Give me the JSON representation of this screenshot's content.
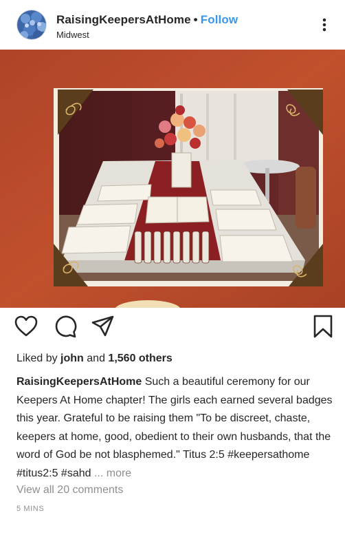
{
  "post": {
    "username": "RaisingKeepersAtHome",
    "separator": "•",
    "follow_label": "Follow",
    "location": "Midwest",
    "likes_prefix": "Liked by",
    "liked_by_user": "john",
    "likes_and": "and",
    "likes_count": "1,560 others",
    "caption_user": "RaisingKeepersAtHome",
    "caption_text": " Such a beautiful ceremony for our Keepers At Home chapter! The girls each earned several badges this year. Grateful to be raising them \"To be discreet, chaste, keepers at home, good, obedient to their own husbands, that the word of God be not blasphemed.\" Titus 2:5 #keepersathome #titus2:5 #sahd ",
    "caption_more": "... more",
    "view_comments": "View all 20 comments",
    "timestamp": "5 MINS"
  },
  "icons": {
    "avatar": "avatar-flowers",
    "more": "more-options-icon",
    "like": "heart-icon",
    "comment": "comment-icon",
    "share": "share-icon",
    "save": "bookmark-icon"
  },
  "colors": {
    "follow": "#3897f0",
    "text": "#262626",
    "muted": "#8e8e8e",
    "photo_background": "#c4512e"
  }
}
